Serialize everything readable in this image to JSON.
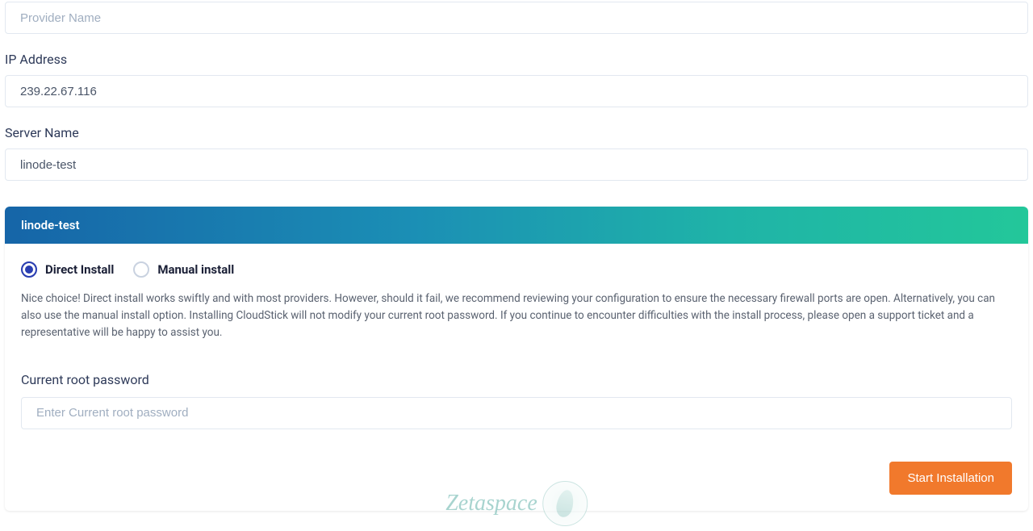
{
  "fields": {
    "provider_name": {
      "placeholder": "Provider Name",
      "value": ""
    },
    "ip_address": {
      "label": "IP Address",
      "value": "239.22.67.116"
    },
    "server_name": {
      "label": "Server Name",
      "value": "linode-test"
    }
  },
  "card": {
    "title": "linode-test",
    "install_options": {
      "direct": "Direct Install",
      "manual": "Manual install",
      "selected": "direct"
    },
    "help_text": "Nice choice! Direct install works swiftly and with most providers. However, should it fail, we recommend reviewing your configuration to ensure the necessary firewall ports are open. Alternatively, you can also use the manual install option. Installing CloudStick will not modify your current root password. If you continue to encounter difficulties with the install process, please open a support ticket and a representative will be happy to assist you.",
    "root_password": {
      "label": "Current root password",
      "placeholder": "Enter Current root password",
      "value": ""
    },
    "start_button": "Start Installation"
  },
  "watermark": "Zetaspace"
}
